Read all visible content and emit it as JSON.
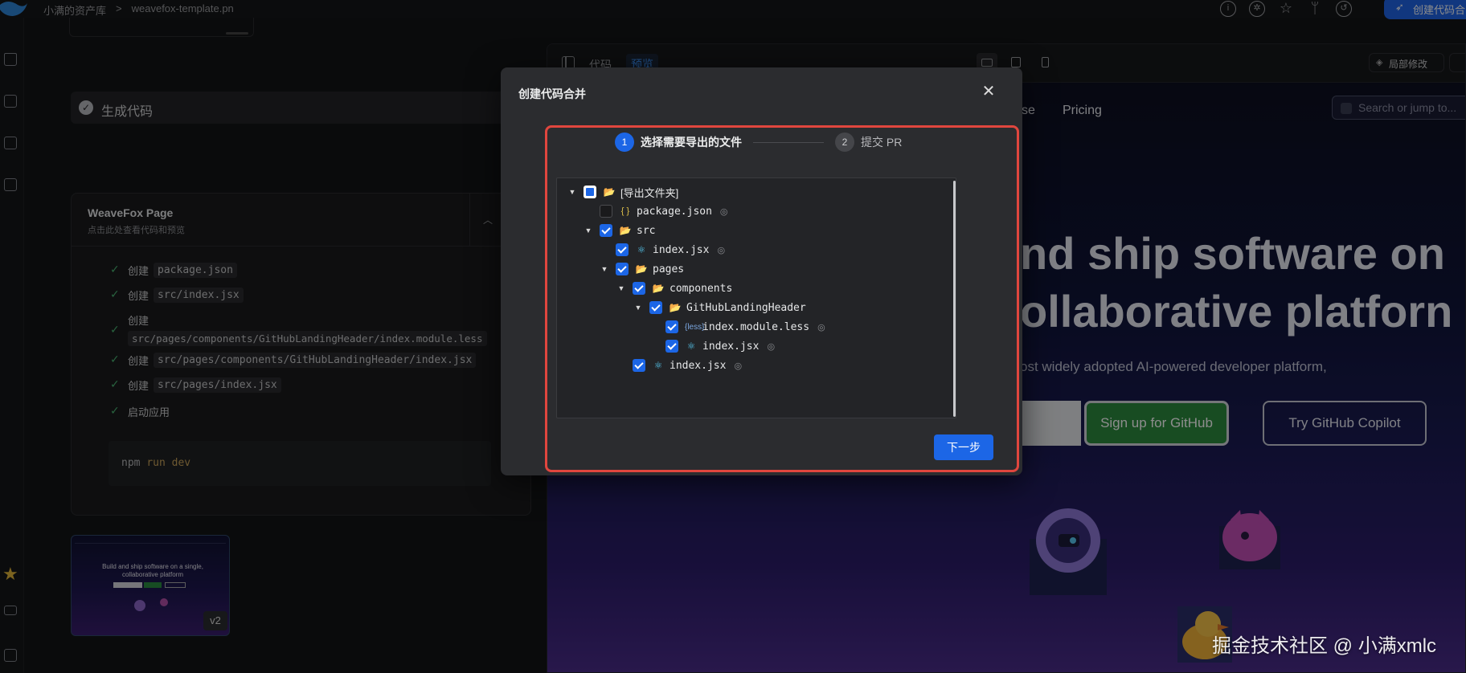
{
  "topbar": {
    "breadcrumb": [
      "小满的资产库",
      ">",
      "weavefox-template.pn"
    ],
    "create_button": "创建代码合"
  },
  "chat": {
    "generate_label": "生成代码",
    "page_card": {
      "title": "WeaveFox Page",
      "subtitle": "点击此处查看代码和预览"
    },
    "steps": [
      {
        "label": "创建",
        "file": "package.json"
      },
      {
        "label": "创建",
        "file": "src/index.jsx"
      },
      {
        "label": "创建",
        "file": "src/pages/components/GitHubLandingHeader/index.module.less"
      },
      {
        "label": "创建",
        "file": "src/pages/components/GitHubLandingHeader/index.jsx"
      },
      {
        "label": "创建",
        "file": "src/pages/index.jsx"
      },
      {
        "label": "启动应用",
        "file": ""
      }
    ],
    "command": {
      "npm": "npm",
      "run": "run",
      "dev": "dev"
    },
    "thumbnail": {
      "title": "Build and ship software on a single, collaborative platform",
      "version": "v2"
    }
  },
  "preview": {
    "tab_code": "代码",
    "tab_preview": "预览",
    "local_edit": "局部修改",
    "site": {
      "nav_suffix": "se",
      "nav_pricing": "Pricing",
      "search_placeholder": "Search or jump to...",
      "hero_line1": "nd ship software on",
      "hero_line2": "ollaborative platforn",
      "hero_sub": "ost widely adopted AI-powered developer platform,",
      "signup": "Sign up for GitHub",
      "copilot": "Try GitHub Copilot"
    }
  },
  "modal": {
    "title": "创建代码合并",
    "step1_num": "1",
    "step1_label": "选择需要导出的文件",
    "step2_num": "2",
    "step2_label": "提交 PR",
    "tree": [
      {
        "name": "[导出文件夹]",
        "state": "partial",
        "type": "folder",
        "expanded": true
      },
      {
        "name": "package.json",
        "state": "unchecked",
        "type": "json"
      },
      {
        "name": "src",
        "state": "checked",
        "type": "folder",
        "expanded": true
      },
      {
        "name": "index.jsx",
        "state": "checked",
        "type": "react"
      },
      {
        "name": "pages",
        "state": "checked",
        "type": "folder",
        "expanded": true
      },
      {
        "name": "components",
        "state": "checked",
        "type": "folder",
        "expanded": true
      },
      {
        "name": "GitHubLandingHeader",
        "state": "checked",
        "type": "folder",
        "expanded": true
      },
      {
        "name": "index.module.less",
        "state": "checked",
        "type": "less"
      },
      {
        "name": "index.jsx",
        "state": "checked",
        "type": "react"
      },
      {
        "name": "index.jsx",
        "state": "checked",
        "type": "react"
      }
    ],
    "next_button": "下一步"
  },
  "watermark": "掘金技术社区 @ 小满xmlc",
  "colors": {
    "accent": "#1c66e6",
    "highlight_border": "#e0463e",
    "success": "#4bb473",
    "github_green": "#2d8a3f"
  }
}
